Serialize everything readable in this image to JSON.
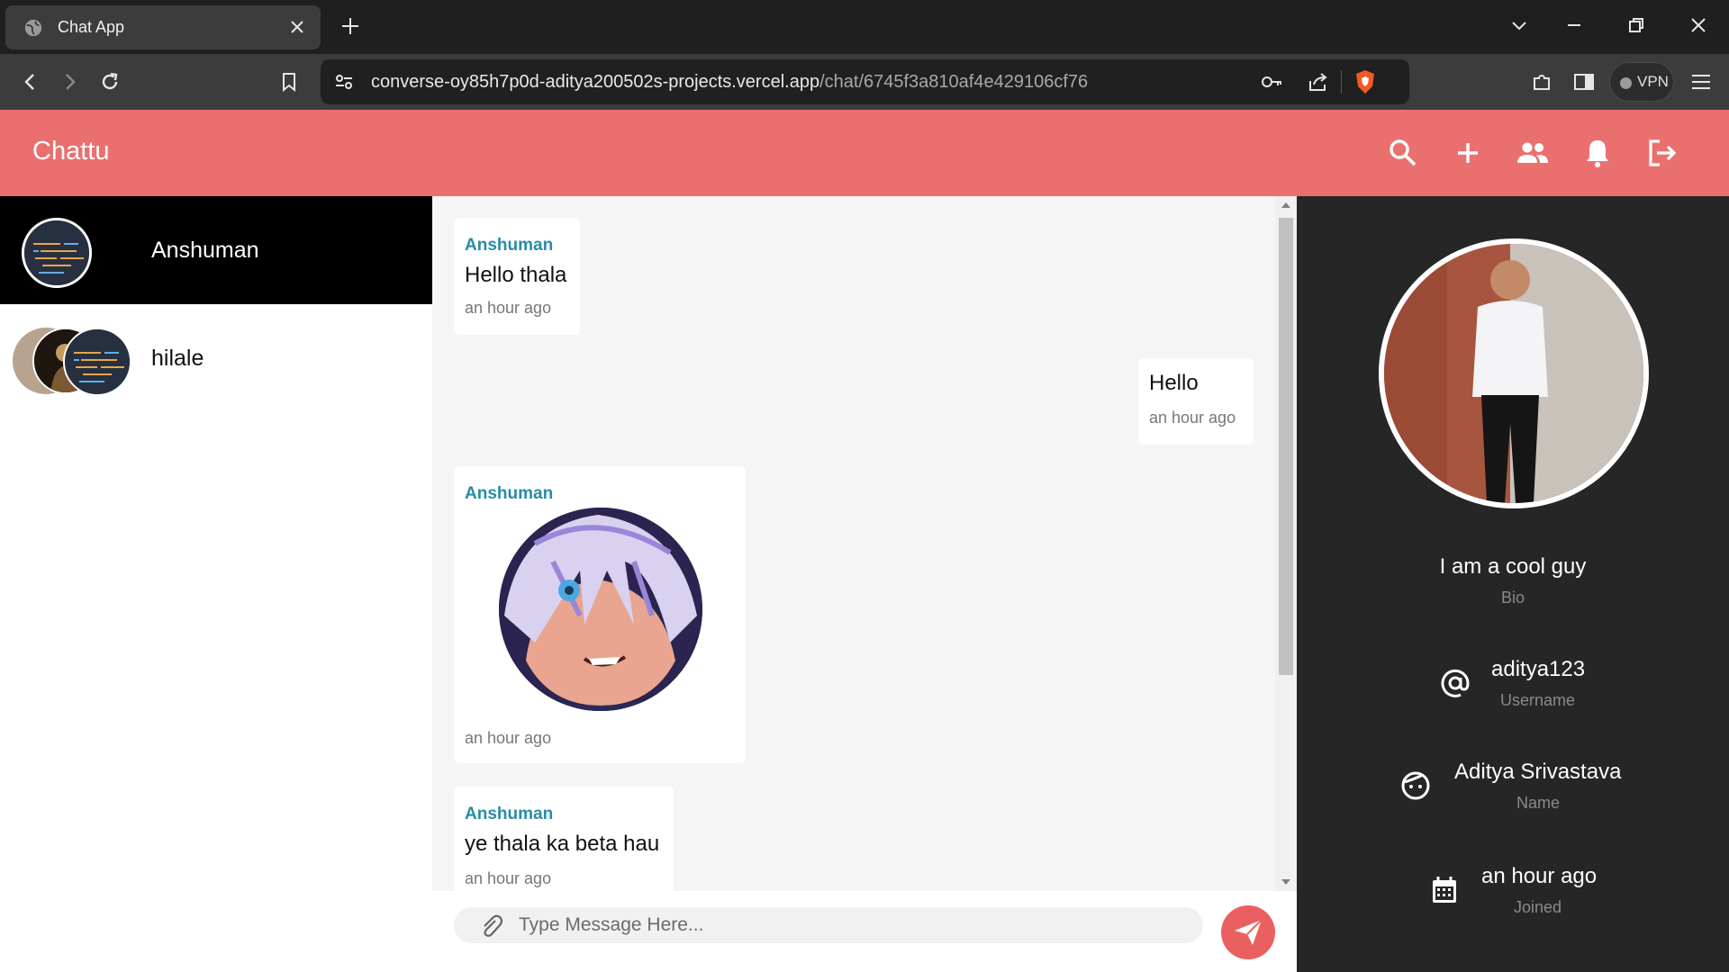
{
  "browser": {
    "tab_title": "Chat App",
    "url_host": "converse-oy85h7p0d-aditya200502s-projects.vercel.app",
    "url_path": "/chat/6745f3a810af4e429106cf76",
    "vpn_label": "VPN"
  },
  "app": {
    "brand": "Chattu",
    "header_icons": [
      "search-icon",
      "add-icon",
      "group-icon",
      "notifications-icon",
      "logout-icon"
    ],
    "accent_color": "#ea7070"
  },
  "sidebar": {
    "chats": [
      {
        "name": "Anshuman",
        "active": true
      },
      {
        "name": "hilale",
        "active": false
      }
    ]
  },
  "messages": [
    {
      "sender": "Anshuman",
      "text": "Hello thala",
      "time": "an hour ago",
      "side": "left"
    },
    {
      "sender": "",
      "text": "Hello",
      "time": "an hour ago",
      "side": "right"
    },
    {
      "sender": "Anshuman",
      "attachment": "image",
      "time": "an hour ago",
      "side": "left"
    },
    {
      "sender": "Anshuman",
      "text": "ye thala ka beta hau",
      "time": "an hour ago",
      "side": "left"
    }
  ],
  "composer": {
    "placeholder": "Type Message Here..."
  },
  "profile": {
    "bio": "I am a cool guy",
    "bio_label": "Bio",
    "username": "aditya123",
    "username_label": "Username",
    "name": "Aditya Srivastava",
    "name_label": "Name",
    "joined": "an hour ago",
    "joined_label": "Joined"
  }
}
